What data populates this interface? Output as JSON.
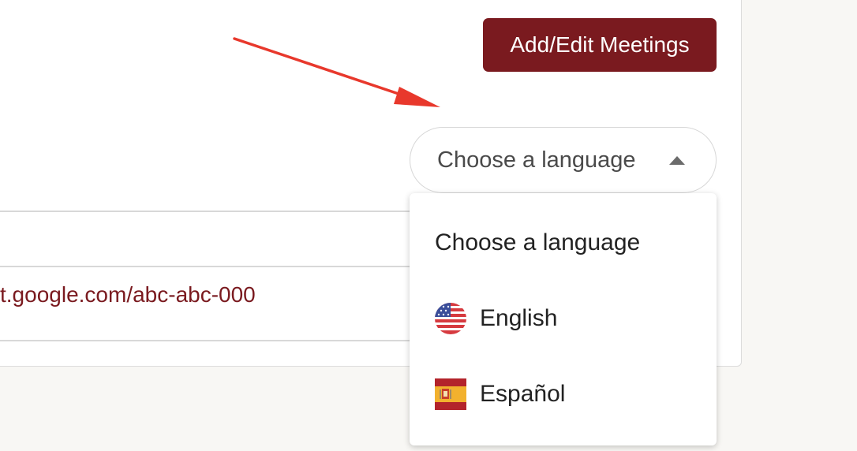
{
  "header": {
    "add_edit_button_label": "Add/Edit Meetings"
  },
  "language_select": {
    "selected_label": "Choose a language",
    "options": [
      {
        "label": "Choose a language",
        "flag": null
      },
      {
        "label": "English",
        "flag": "us-flag-icon"
      },
      {
        "label": "Español",
        "flag": "spain-flag-icon"
      }
    ]
  },
  "meeting": {
    "link_text": "t.google.com/abc-abc-000"
  },
  "colors": {
    "brand": "#7a1a1f",
    "annotation_arrow": "#e8382c",
    "page_background": "#f8f7f4"
  }
}
